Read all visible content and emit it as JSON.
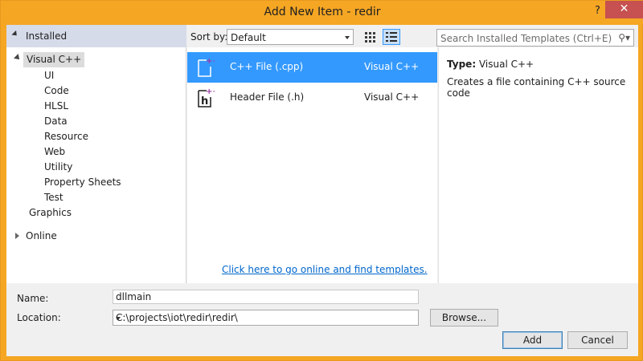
{
  "window": {
    "title": "Add New Item - redir",
    "help_glyph": "?",
    "close_glyph": "✕"
  },
  "sidebar": {
    "installed_label": "Installed",
    "visual_cpp_label": "Visual C++",
    "children": [
      "UI",
      "Code",
      "HLSL",
      "Data",
      "Resource",
      "Web",
      "Utility",
      "Property Sheets",
      "Test"
    ],
    "graphics_label": "Graphics",
    "online_label": "Online"
  },
  "toolbar": {
    "sort_label": "Sort by:",
    "sort_value": "Default",
    "search_placeholder": "Search Installed Templates (Ctrl+E)",
    "search_icon": "search-icon"
  },
  "templates": [
    {
      "name": "C++ File (.cpp)",
      "language": "Visual C++",
      "selected": true,
      "icon": "cpp-file-icon"
    },
    {
      "name": "Header File (.h)",
      "language": "Visual C++",
      "selected": false,
      "icon": "header-file-icon"
    }
  ],
  "online_link": "Click here to go online and find templates.",
  "details": {
    "type_label": "Type:",
    "type_value": "Visual C++",
    "description": "Creates a file containing C++ source code"
  },
  "form": {
    "name_label": "Name:",
    "name_value": "dllmain",
    "location_label": "Location:",
    "location_value": "C:\\projects\\iot\\redir\\redir\\",
    "browse_label": "Browse...",
    "add_label": "Add",
    "cancel_label": "Cancel"
  },
  "colors": {
    "title_bar": "#f5a623",
    "selection": "#3399ff",
    "close_button": "#c75050",
    "link": "#0066cc",
    "icon_accent": "#9b3ca6"
  }
}
